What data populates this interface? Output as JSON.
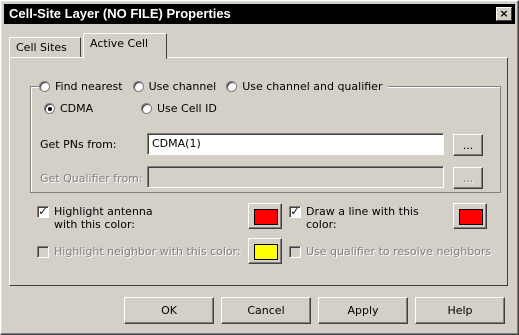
{
  "window": {
    "title": "Cell-Site Layer (NO FILE) Properties",
    "close_glyph": "×"
  },
  "tabs": [
    {
      "label": "Cell Sites",
      "active": false
    },
    {
      "label": "Active Cell",
      "active": true
    }
  ],
  "mode_options": {
    "find_nearest": {
      "label": "Find nearest",
      "checked": false
    },
    "use_channel": {
      "label": "Use channel",
      "checked": false
    },
    "use_channel_and_qualifier": {
      "label": "Use channel and qualifier",
      "checked": false
    },
    "cdma": {
      "label": "CDMA",
      "checked": true
    },
    "use_cell_id": {
      "label": "Use Cell ID",
      "checked": false
    }
  },
  "get_pns": {
    "label": "Get PNs from:",
    "value": "CDMA(1)",
    "browse": "..."
  },
  "get_qualifier": {
    "label": "Get Qualifier from:",
    "value": "",
    "browse": "..."
  },
  "highlight_antenna": {
    "line1": "Highlight antenna",
    "line2": "with this color:",
    "checked": true,
    "color": "#ff0000"
  },
  "draw_line": {
    "line1": "Draw a line with this",
    "line2": "color:",
    "checked": true,
    "color": "#ff0000"
  },
  "highlight_neighbor": {
    "label": "Highlight neighbor with this color:",
    "checked": false,
    "color": "#ffff00"
  },
  "use_qualifier": {
    "label": "Use qualifier to resolve neighbors",
    "checked": false
  },
  "buttons": {
    "ok": "OK",
    "cancel": "Cancel",
    "apply": "Apply",
    "help": "Help"
  },
  "check_glyph": "✓"
}
